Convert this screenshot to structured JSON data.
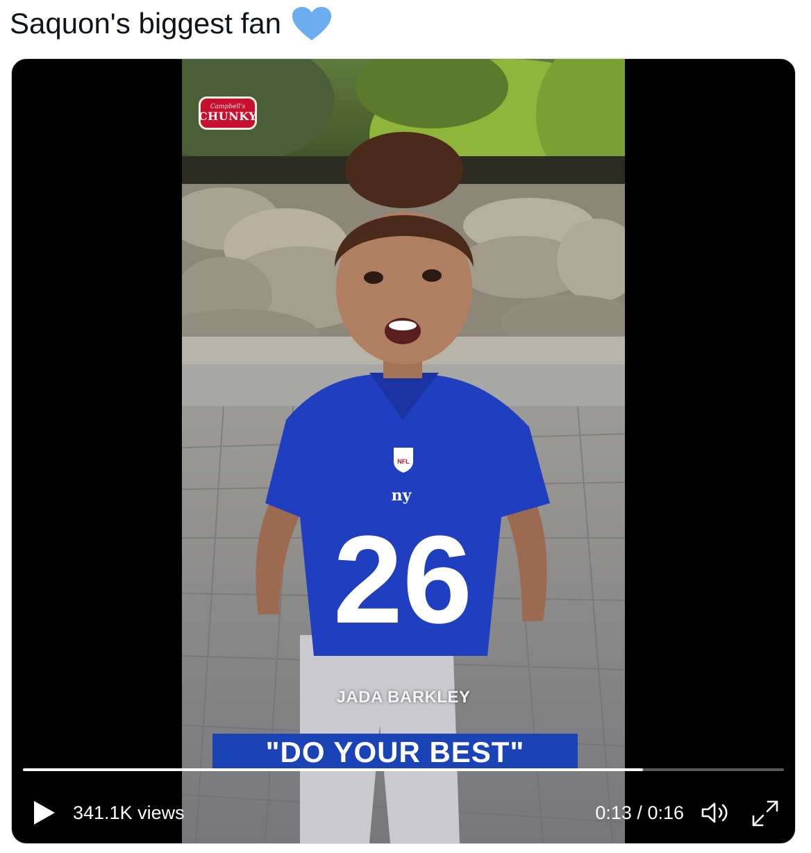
{
  "tweet": {
    "text": "Saquon's biggest fan",
    "emoji_icon": "blue-heart-icon",
    "emoji_color": "#6cadef"
  },
  "video": {
    "logo": {
      "brand": "Campbell's",
      "name": "CHUNKY"
    },
    "jersey": {
      "team": "ny",
      "number": "26",
      "league": "NFL"
    },
    "caption_name": "JADA BARKLEY",
    "caption_quote": "\"DO YOUR BEST\"",
    "progress_fraction": 0.815,
    "views": "341.1K views",
    "current_time": "0:13",
    "separator": "/",
    "duration": "0:16",
    "icons": {
      "play": "play-icon",
      "volume": "volume-icon",
      "fullscreen": "fullscreen-icon"
    },
    "colors": {
      "jersey_blue": "#1f3ec0",
      "caption_bar": "#1a43b5",
      "logo_red": "#c8102e"
    }
  }
}
